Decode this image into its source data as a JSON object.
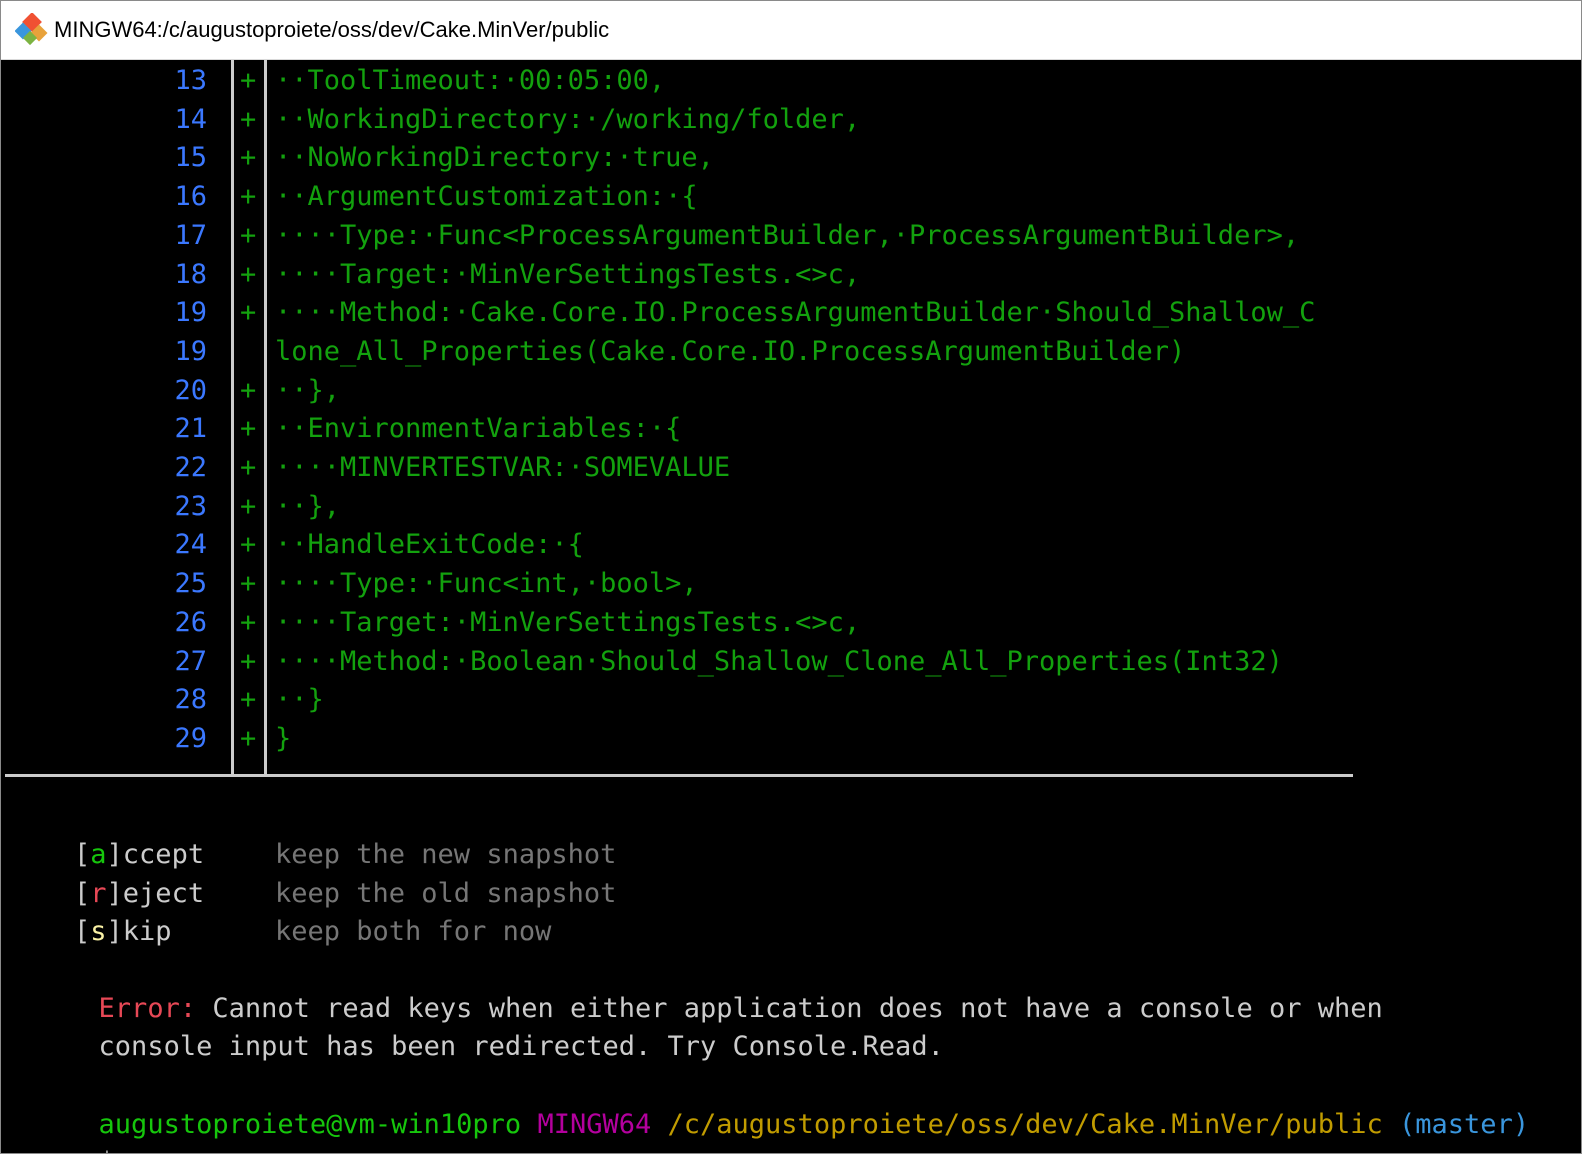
{
  "window": {
    "title": "MINGW64:/c/augustoproiete/oss/dev/Cake.MinVer/public"
  },
  "icons": {
    "app": "git-bash-icon"
  },
  "colors": {
    "line_number": "#3b78ff",
    "added": "#13a10e",
    "error": "#e74856",
    "prompt_user": "#16c60c",
    "prompt_system": "#b4009e",
    "prompt_path": "#c19c00",
    "prompt_branch": "#3a96dd"
  },
  "diff": {
    "lines": [
      {
        "num": "13",
        "marker": "+",
        "text": "··ToolTimeout:·00:05:00,"
      },
      {
        "num": "14",
        "marker": "+",
        "text": "··WorkingDirectory:·/working/folder,"
      },
      {
        "num": "15",
        "marker": "+",
        "text": "··NoWorkingDirectory:·true,"
      },
      {
        "num": "16",
        "marker": "+",
        "text": "··ArgumentCustomization:·{"
      },
      {
        "num": "17",
        "marker": "+",
        "text": "····Type:·Func<ProcessArgumentBuilder,·ProcessArgumentBuilder>,"
      },
      {
        "num": "18",
        "marker": "+",
        "text": "····Target:·MinVerSettingsTests.<>c,"
      },
      {
        "num": "19",
        "marker": "+",
        "text": "····Method:·Cake.Core.IO.ProcessArgumentBuilder·Should_Shallow_C"
      },
      {
        "num": "19",
        "marker": "",
        "text": "lone_All_Properties(Cake.Core.IO.ProcessArgumentBuilder)"
      },
      {
        "num": "20",
        "marker": "+",
        "text": "··},"
      },
      {
        "num": "21",
        "marker": "+",
        "text": "··EnvironmentVariables:·{"
      },
      {
        "num": "22",
        "marker": "+",
        "text": "····MINVERTESTVAR:·SOMEVALUE"
      },
      {
        "num": "23",
        "marker": "+",
        "text": "··},"
      },
      {
        "num": "24",
        "marker": "+",
        "text": "··HandleExitCode:·{"
      },
      {
        "num": "25",
        "marker": "+",
        "text": "····Type:·Func<int,·bool>,"
      },
      {
        "num": "26",
        "marker": "+",
        "text": "····Target:·MinVerSettingsTests.<>c,"
      },
      {
        "num": "27",
        "marker": "+",
        "text": "····Method:·Boolean·Should_Shallow_Clone_All_Properties(Int32)"
      },
      {
        "num": "28",
        "marker": "+",
        "text": "··}"
      },
      {
        "num": "29",
        "marker": "+",
        "text": "}"
      }
    ]
  },
  "options": [
    {
      "open": "[",
      "key": "a",
      "close": "]",
      "rest": "ccept",
      "description": "keep the new snapshot"
    },
    {
      "open": "[",
      "key": "r",
      "close": "]",
      "rest": "eject",
      "description": "keep the old snapshot"
    },
    {
      "open": "[",
      "key": "s",
      "close": "]",
      "rest": "kip",
      "description": "keep both for now"
    }
  ],
  "error": {
    "label": "Error:",
    "line1": " Cannot read keys when either application does not have a console or when",
    "line2": "console input has been redirected. Try Console.Read."
  },
  "prompt": {
    "user_host": "augustoproiete@vm-win10pro",
    "system": "MINGW64",
    "path": "/c/augustoproiete/oss/dev/Cake.MinVer/public",
    "branch": "(master)",
    "symbol": "$"
  }
}
